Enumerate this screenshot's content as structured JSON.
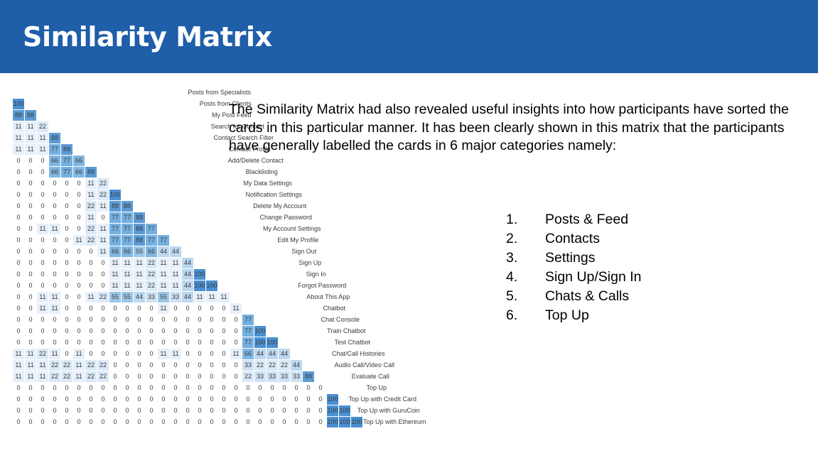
{
  "header": {
    "title": "Similarity Matrix",
    "bg_color": "#1f5ea8",
    "text_color": "#ffffff"
  },
  "body": {
    "paragraph": "The Similarity Matrix had also revealed useful insights into how participants have sorted the cards in this particular manner.  It has been clearly shown in this matrix that the participants have generally labelled the cards in 6 major categories namely:"
  },
  "categories": [
    {
      "num": "1.",
      "label": "Posts & Feed"
    },
    {
      "num": "2.",
      "label": "Contacts"
    },
    {
      "num": "3.",
      "label": "Settings"
    },
    {
      "num": "4.",
      "label": "Sign Up/Sign In"
    },
    {
      "num": "5.",
      "label": "Chats & Calls"
    },
    {
      "num": "6.",
      "label": "Top Up"
    }
  ],
  "chart_data": {
    "type": "heatmap",
    "title": "Similarity Matrix",
    "xlabel": "",
    "ylabel": "",
    "note": "Lower-triangular similarity matrix; each row label names the card, each cell is the percentage co-occurrence with the card of the corresponding column index.",
    "value_scale": [
      0,
      11,
      22,
      33,
      44,
      55,
      66,
      77,
      88,
      100
    ],
    "color_scale": {
      "0": "#ffffff",
      "11": "#e7f0fa",
      "22": "#dbe9f7",
      "33": "#cfe2f4",
      "44": "#bcd8ef",
      "55": "#9dc7e8",
      "66": "#7fb7e3",
      "77": "#74b0e0",
      "88": "#5b9bd5",
      "100": "#4a90d2"
    },
    "labels": [
      "Posts from Specialists",
      "Posts from Clients",
      "My Post Feed",
      "Search for Contact",
      "Contact Search Filter",
      "Contact Profile",
      "Add/Delete Contact",
      "Blacklisting",
      "My Data Settings",
      "Notification Settings",
      "Delete My Account",
      "Change Password",
      "My Account Settings",
      "Edit My Profile",
      "Sign Out",
      "Sign Up",
      "Sign In",
      "Forgot Password",
      "About This App",
      "Chatbot",
      "Chat Console",
      "Train Chatbot",
      "Test Chatbot",
      "Chat/Call Histories",
      "Audio Call/Video Call",
      "Evaluate Call",
      "Top Up",
      "Top Up with Credit Card",
      "Top Up with GuruCoin",
      "Top Up with Ethereum"
    ],
    "rows": [
      {
        "label": "Posts from Specialists",
        "values": []
      },
      {
        "label": "Posts from Clients",
        "values": [
          100
        ]
      },
      {
        "label": "My Post Feed",
        "values": [
          88,
          88
        ]
      },
      {
        "label": "Search for Contact",
        "values": [
          11,
          11,
          22
        ]
      },
      {
        "label": "Contact Search Filter",
        "values": [
          11,
          11,
          11,
          88
        ]
      },
      {
        "label": "Contact Profile",
        "values": [
          11,
          11,
          11,
          77,
          88
        ]
      },
      {
        "label": "Add/Delete Contact",
        "values": [
          0,
          0,
          0,
          66,
          77,
          66
        ]
      },
      {
        "label": "Blacklisting",
        "values": [
          0,
          0,
          0,
          66,
          77,
          66,
          88
        ]
      },
      {
        "label": "My Data Settings",
        "values": [
          0,
          0,
          0,
          0,
          0,
          0,
          11,
          22
        ]
      },
      {
        "label": "Notification Settings",
        "values": [
          0,
          0,
          0,
          0,
          0,
          0,
          11,
          22,
          100
        ]
      },
      {
        "label": "Delete My Account",
        "values": [
          0,
          0,
          0,
          0,
          0,
          0,
          22,
          11,
          88,
          88
        ]
      },
      {
        "label": "Change Password",
        "values": [
          0,
          0,
          0,
          0,
          0,
          0,
          11,
          0,
          77,
          77,
          88
        ]
      },
      {
        "label": "My Account Settings",
        "values": [
          0,
          0,
          11,
          11,
          0,
          0,
          22,
          11,
          77,
          77,
          88,
          77
        ]
      },
      {
        "label": "Edit My Profile",
        "values": [
          0,
          0,
          0,
          0,
          0,
          11,
          22,
          11,
          77,
          77,
          88,
          77,
          77
        ]
      },
      {
        "label": "Sign Out",
        "values": [
          0,
          0,
          0,
          0,
          0,
          0,
          0,
          11,
          66,
          66,
          55,
          66,
          44,
          44
        ]
      },
      {
        "label": "Sign Up",
        "values": [
          0,
          0,
          0,
          0,
          0,
          0,
          0,
          0,
          11,
          11,
          11,
          22,
          11,
          11,
          44
        ]
      },
      {
        "label": "Sign In",
        "values": [
          0,
          0,
          0,
          0,
          0,
          0,
          0,
          0,
          11,
          11,
          11,
          22,
          11,
          11,
          44,
          100
        ]
      },
      {
        "label": "Forgot Password",
        "values": [
          0,
          0,
          0,
          0,
          0,
          0,
          0,
          0,
          11,
          11,
          11,
          22,
          11,
          11,
          44,
          100,
          100
        ]
      },
      {
        "label": "About This App",
        "values": [
          0,
          0,
          11,
          11,
          0,
          0,
          11,
          22,
          55,
          55,
          44,
          33,
          55,
          33,
          44,
          11,
          11,
          11
        ]
      },
      {
        "label": "Chatbot",
        "values": [
          0,
          0,
          11,
          11,
          0,
          0,
          0,
          0,
          0,
          0,
          0,
          0,
          11,
          0,
          0,
          0,
          0,
          0,
          11
        ]
      },
      {
        "label": "Chat Console",
        "values": [
          0,
          0,
          0,
          0,
          0,
          0,
          0,
          0,
          0,
          0,
          0,
          0,
          0,
          0,
          0,
          0,
          0,
          0,
          0,
          77
        ]
      },
      {
        "label": "Train Chatbot",
        "values": [
          0,
          0,
          0,
          0,
          0,
          0,
          0,
          0,
          0,
          0,
          0,
          0,
          0,
          0,
          0,
          0,
          0,
          0,
          0,
          77,
          100
        ]
      },
      {
        "label": "Test Chatbot",
        "values": [
          0,
          0,
          0,
          0,
          0,
          0,
          0,
          0,
          0,
          0,
          0,
          0,
          0,
          0,
          0,
          0,
          0,
          0,
          0,
          77,
          100,
          100
        ]
      },
      {
        "label": "Chat/Call Histories",
        "values": [
          11,
          11,
          22,
          11,
          0,
          11,
          0,
          0,
          0,
          0,
          0,
          0,
          11,
          11,
          0,
          0,
          0,
          0,
          11,
          66,
          44,
          44,
          44
        ]
      },
      {
        "label": "Audio Call/Video Call",
        "values": [
          11,
          11,
          11,
          22,
          22,
          11,
          22,
          22,
          0,
          0,
          0,
          0,
          0,
          0,
          0,
          0,
          0,
          0,
          0,
          33,
          22,
          22,
          22,
          44
        ]
      },
      {
        "label": "Evaluate Call",
        "values": [
          11,
          11,
          11,
          22,
          22,
          11,
          22,
          22,
          0,
          0,
          0,
          0,
          0,
          0,
          0,
          0,
          0,
          0,
          0,
          22,
          33,
          33,
          33,
          33,
          88
        ]
      },
      {
        "label": "Top Up",
        "values": [
          0,
          0,
          0,
          0,
          0,
          0,
          0,
          0,
          0,
          0,
          0,
          0,
          0,
          0,
          0,
          0,
          0,
          0,
          0,
          0,
          0,
          0,
          0,
          0,
          0,
          0
        ]
      },
      {
        "label": "Top Up with Credit Card",
        "values": [
          0,
          0,
          0,
          0,
          0,
          0,
          0,
          0,
          0,
          0,
          0,
          0,
          0,
          0,
          0,
          0,
          0,
          0,
          0,
          0,
          0,
          0,
          0,
          0,
          0,
          0,
          100
        ]
      },
      {
        "label": "Top Up with GuruCoin",
        "values": [
          0,
          0,
          0,
          0,
          0,
          0,
          0,
          0,
          0,
          0,
          0,
          0,
          0,
          0,
          0,
          0,
          0,
          0,
          0,
          0,
          0,
          0,
          0,
          0,
          0,
          0,
          100,
          100
        ]
      },
      {
        "label": "Top Up with Ethereum",
        "values": [
          0,
          0,
          0,
          0,
          0,
          0,
          0,
          0,
          0,
          0,
          0,
          0,
          0,
          0,
          0,
          0,
          0,
          0,
          0,
          0,
          0,
          0,
          0,
          0,
          0,
          0,
          100,
          100,
          100
        ]
      }
    ]
  }
}
